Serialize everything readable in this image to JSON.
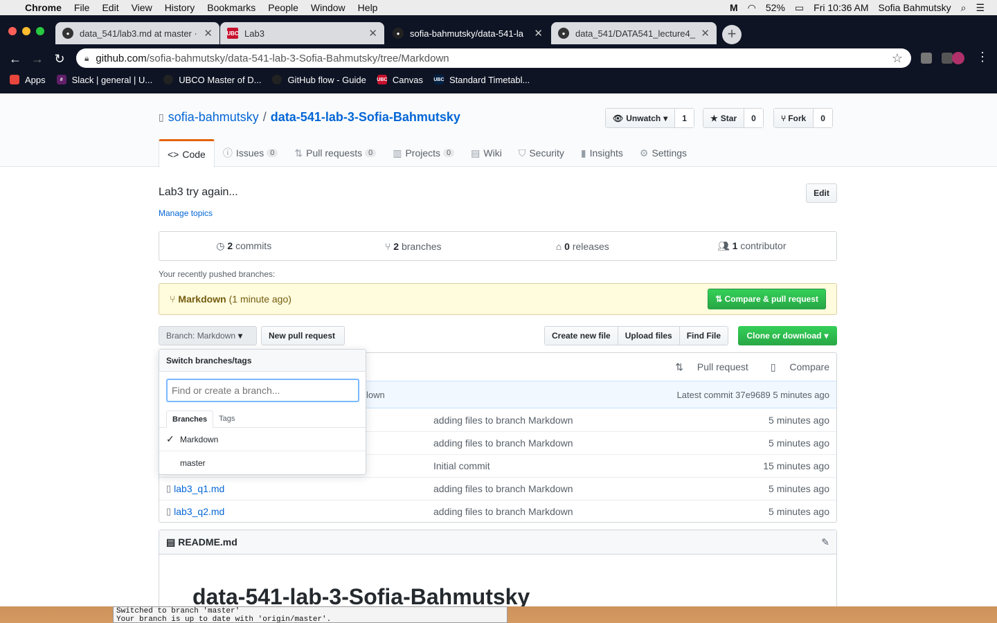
{
  "menubar": {
    "app": "Chrome",
    "items": [
      "File",
      "Edit",
      "View",
      "History",
      "Bookmarks",
      "People",
      "Window",
      "Help"
    ],
    "battery": "52%",
    "clock": "Fri 10:36 AM",
    "user": "Sofia Bahmutsky"
  },
  "browser": {
    "tabs": [
      {
        "title": "data_541/lab3.md at master · ",
        "icon": "github-icon"
      },
      {
        "title": "Lab3",
        "icon": "ubc-icon"
      },
      {
        "title": "sofia-bahmutsky/data-541-la",
        "icon": "github-icon"
      },
      {
        "title": "data_541/DATA541_lecture4_",
        "icon": "github-icon"
      }
    ],
    "url_host": "github.com",
    "url_path": "/sofia-bahmutsky/data-541-lab-3-Sofia-Bahmutsky/tree/Markdown",
    "bookmarks": [
      "Apps",
      "Slack | general | U...",
      "UBCO Master of D...",
      "GitHub flow - Guide",
      "Canvas",
      "Standard Timetabl..."
    ]
  },
  "repo": {
    "owner": "sofia-bahmutsky",
    "name": "data-541-lab-3-Sofia-Bahmutsky",
    "watch_label": "Unwatch",
    "watch_count": "1",
    "star_label": "Star",
    "star_count": "0",
    "fork_label": "Fork",
    "fork_count": "0"
  },
  "nav": [
    {
      "label": "Code",
      "count": ""
    },
    {
      "label": "Issues",
      "count": "0"
    },
    {
      "label": "Pull requests",
      "count": "0"
    },
    {
      "label": "Projects",
      "count": "0"
    },
    {
      "label": "Wiki",
      "count": ""
    },
    {
      "label": "Security",
      "count": ""
    },
    {
      "label": "Insights",
      "count": ""
    },
    {
      "label": "Settings",
      "count": ""
    }
  ],
  "description": "Lab3 try again...",
  "manage_topics": "Manage topics",
  "edit_label": "Edit",
  "summary": {
    "commits_n": "2",
    "commits_label": "commits",
    "branches_n": "2",
    "branches_label": "branches",
    "releases_n": "0",
    "releases_label": "releases",
    "contributors_n": "1",
    "contributors_label": "contributor"
  },
  "recent_label": "Your recently pushed branches:",
  "pushed": {
    "branch": "Markdown",
    "when": "(1 minute ago)",
    "compare_label": "Compare & pull request"
  },
  "branch_button": "Branch: Markdown",
  "new_pr": "New pull request",
  "file_actions": [
    "Create new file",
    "Upload files",
    "Find File"
  ],
  "clone_label": "Clone or download",
  "filebox": {
    "pull_request": "Pull request",
    "compare": "Compare",
    "commit_msg_tail": "lown",
    "latest_commit": "Latest commit 37e9689 5 minutes ago",
    "files": [
      {
        "name": "",
        "message": "adding files to branch Markdown",
        "age": "5 minutes ago"
      },
      {
        "name": "",
        "message": "adding files to branch Markdown",
        "age": "5 minutes ago"
      },
      {
        "name": "",
        "message": "Initial commit",
        "age": "15 minutes ago"
      },
      {
        "name": "lab3_q1.md",
        "message": "adding files to branch Markdown",
        "age": "5 minutes ago"
      },
      {
        "name": "lab3_q2.md",
        "message": "adding files to branch Markdown",
        "age": "5 minutes ago"
      }
    ]
  },
  "readme": {
    "filename": "README.md",
    "title": "data-541-lab-3-Sofia-Bahmutsky"
  },
  "dropdown": {
    "title": "Switch branches/tags",
    "placeholder": "Find or create a branch...",
    "tab_branches": "Branches",
    "tab_tags": "Tags",
    "branches": [
      "Markdown",
      "master"
    ]
  },
  "terminal": [
    "Switched to branch 'master'",
    "Your branch is up to date with 'origin/master'."
  ]
}
